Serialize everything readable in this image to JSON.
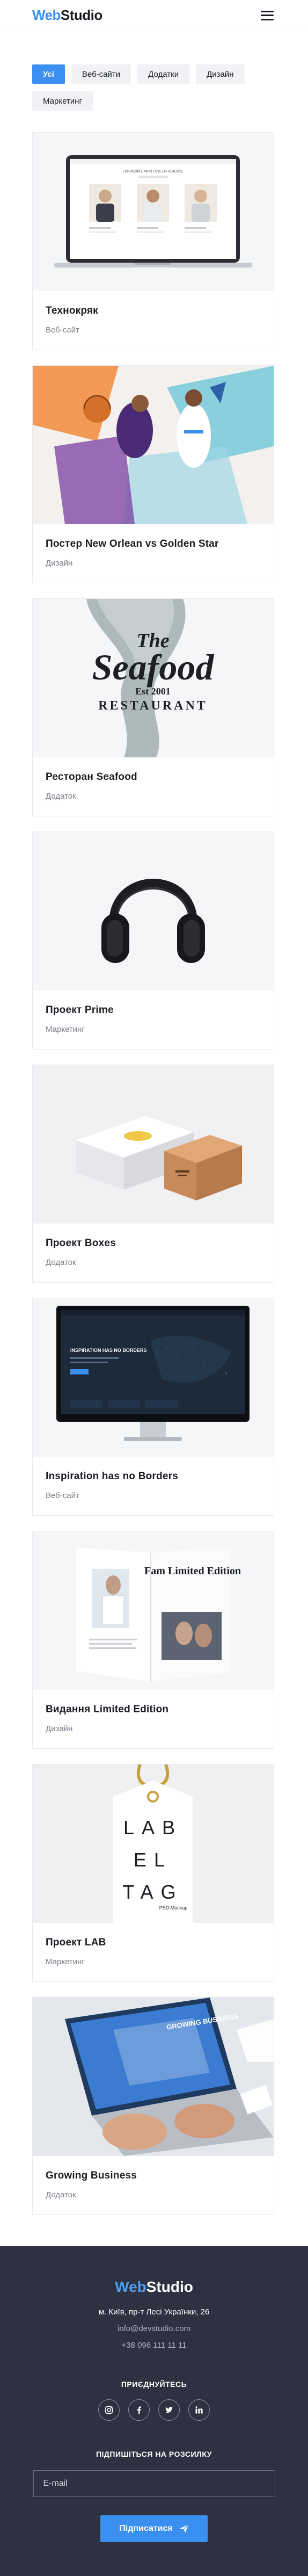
{
  "header": {
    "logo_a": "Web",
    "logo_b": "Studio",
    "menu_icon": "hamburger-icon"
  },
  "filters": [
    {
      "label": "Усі",
      "active": true
    },
    {
      "label": "Веб-сайти",
      "active": false
    },
    {
      "label": "Додатки",
      "active": false
    },
    {
      "label": "Дизайн",
      "active": false
    },
    {
      "label": "Маркетинг",
      "active": false
    }
  ],
  "projects": [
    {
      "title": "Технокряк",
      "category": "Веб-сайт",
      "image": "laptop-mockup"
    },
    {
      "title": "Постер New Orlean vs Golden Star",
      "category": "Дизайн",
      "image": "basketball-poster"
    },
    {
      "title": "Ресторан Seafood",
      "category": "Додаток",
      "image": "seafood-logo"
    },
    {
      "title": "Проект Prime",
      "category": "Маркетинг",
      "image": "headphones"
    },
    {
      "title": "Проект Boxes",
      "category": "Додаток",
      "image": "boxes"
    },
    {
      "title": "Inspiration has no Borders",
      "category": "Веб-сайт",
      "image": "monitor-mockup"
    },
    {
      "title": "Видання Limited Edition",
      "category": "Дизайн",
      "image": "magazine"
    },
    {
      "title": "Проект LAB",
      "category": "Маркетинг",
      "image": "label-tag"
    },
    {
      "title": "Growing Business",
      "category": "Додаток",
      "image": "laptop-hands"
    }
  ],
  "mockup_text": {
    "laptop_heading": "FOR PEOPLE WHO LOVE DIFFERENCE",
    "seafood_the": "The",
    "seafood_main": "Seafood",
    "seafood_est": "Est 2001",
    "seafood_restaurant": "RESTAURANT",
    "monitor_heading": "INSPIRATION HAS NO BORDERS",
    "magazine_title": "Fam Limited Edition",
    "tag_line1": "LAB",
    "tag_line2": "EL",
    "tag_line3": "TAG",
    "tag_small": "PSD Mockup",
    "screen_text": "GROWING BUSINESS"
  },
  "footer": {
    "logo_a": "Web",
    "logo_b": "Studio",
    "address": "м. Київ, пр-т Лесі Українки, 26",
    "email": "info@devstudio.com",
    "phone": "+38 096 111 11 11",
    "join_heading": "ПРИЄДНУЙТЕСЬ",
    "socials": [
      "instagram-icon",
      "facebook-icon",
      "twitter-icon",
      "linkedin-icon"
    ],
    "subscribe_heading": "ПІДПИШІТЬСЯ НА РОЗСИЛКУ",
    "email_placeholder": "E-mail",
    "subscribe_button": "Підписатися"
  },
  "colors": {
    "accent": "#3a8ff0",
    "footer_bg": "#2e3140",
    "text": "#1b1d24",
    "muted": "#7c7f89"
  }
}
